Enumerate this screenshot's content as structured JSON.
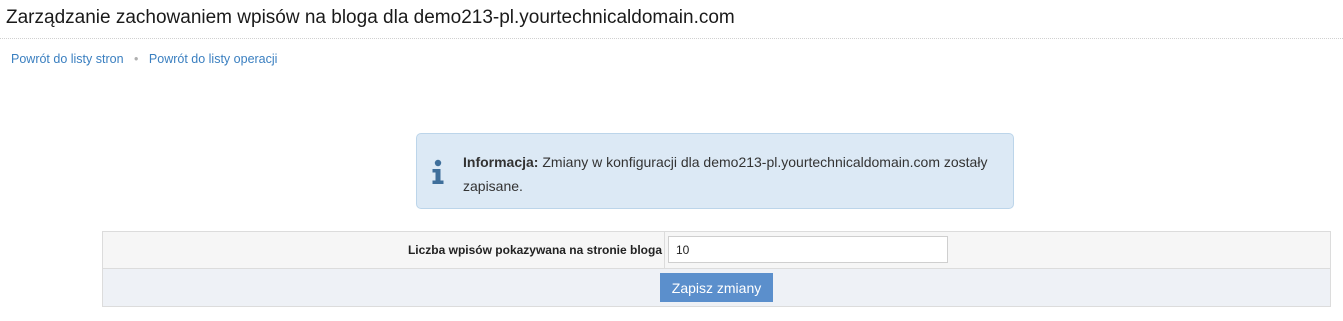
{
  "page": {
    "title": "Zarządzanie zachowaniem wpisów na bloga dla demo213-pl.yourtechnicaldomain.com"
  },
  "breadcrumb": {
    "items": [
      {
        "label": "Powrót do listy stron"
      },
      {
        "label": "Powrót do listy operacji"
      }
    ],
    "separator": "•"
  },
  "info": {
    "icon": "info-icon",
    "heading": "Informacja:",
    "message": "Zmiany w konfiguracji dla demo213-pl.yourtechnicaldomain.com zostały zapisane."
  },
  "form": {
    "posts_per_page_label": "Liczba wpisów pokazywana na stronie bloga",
    "posts_per_page_value": "10",
    "save_label": "Zapisz zmiany"
  },
  "colors": {
    "link": "#3a7fc0",
    "info_background": "#dce9f5",
    "info_border": "#bcd5ea",
    "info_icon": "#3f6f9b",
    "button_background": "#5b8fcc",
    "button_text": "#ffffff"
  }
}
